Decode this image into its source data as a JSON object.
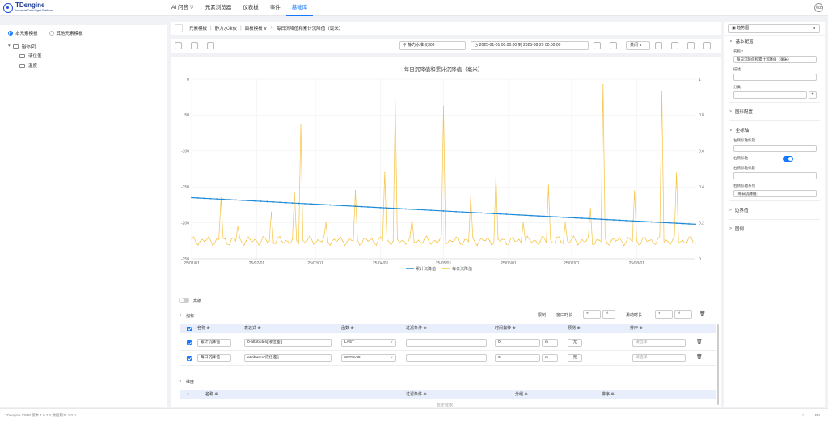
{
  "app": {
    "title": "TDengine",
    "subtitle": "Industrial Data Mgmt Platform",
    "user_initials": "WZ"
  },
  "nav": [
    {
      "label": "AI 问答 ▽"
    },
    {
      "label": "元素浏览器"
    },
    {
      "label": "仪表板"
    },
    {
      "label": "事件"
    },
    {
      "label": "基础库"
    }
  ],
  "left": {
    "radio_this": "本元素模板",
    "radio_other": "其他元素模板",
    "tree_group": "指标(2)",
    "tree_items": [
      "液位差",
      "温度"
    ]
  },
  "breadcrumb": [
    "元素模板",
    "静力水准仪",
    "面板模板 ∨",
    "每日沉降值和累计沉降值（毫米）"
  ],
  "toolbar": {
    "device": "静力水准仪308",
    "time_range": "2025-01-01 00:00:00 到 2025-08-29 00:00:00",
    "refresh": "关闭",
    "view": "趋势图"
  },
  "chart_data": {
    "type": "line",
    "title": "每日沉降值和累计沉降值（毫米）",
    "x": [
      "25/01/01",
      "25/02/01",
      "25/03/01",
      "25/04/01",
      "25/05/01",
      "25/06/01",
      "25/07/01",
      "25/08/01"
    ],
    "y_left_ticks": [
      "0",
      "-50",
      "-100",
      "-150",
      "-200",
      "-250"
    ],
    "y_right_ticks": [
      "1",
      "0.8",
      "0.6",
      "0.4",
      "0.2",
      "0"
    ],
    "ylim_left": [
      -250,
      0
    ],
    "ylim_right": [
      0,
      1
    ],
    "series": [
      {
        "name": "累计沉降值",
        "color": "#1f8ad6",
        "axis": "left",
        "start": -165,
        "end": -202
      },
      {
        "name": "每日沉降值",
        "color": "#f5c242",
        "axis": "right",
        "baseline": 0.1,
        "spikes": [
          {
            "day": 14,
            "v": 0.34
          },
          {
            "day": 22,
            "v": 0.18
          },
          {
            "day": 38,
            "v": 0.26
          },
          {
            "day": 49,
            "v": 0.37
          },
          {
            "day": 52,
            "v": 0.75
          },
          {
            "day": 64,
            "v": 0.2
          },
          {
            "day": 78,
            "v": 0.38
          },
          {
            "day": 92,
            "v": 0.48
          },
          {
            "day": 97,
            "v": 0.88
          },
          {
            "day": 105,
            "v": 0.22
          },
          {
            "day": 120,
            "v": 0.85
          },
          {
            "day": 133,
            "v": 0.35
          },
          {
            "day": 145,
            "v": 0.47
          },
          {
            "day": 158,
            "v": 0.2
          },
          {
            "day": 170,
            "v": 0.41
          },
          {
            "day": 178,
            "v": 0.2
          },
          {
            "day": 190,
            "v": 0.28
          },
          {
            "day": 196,
            "v": 0.97
          },
          {
            "day": 211,
            "v": 0.38
          },
          {
            "day": 224,
            "v": 0.93
          },
          {
            "day": 231,
            "v": 0.48
          }
        ]
      }
    ],
    "legend": "bottom-center"
  },
  "panel": {
    "advanced": "高级",
    "metrics_title": "指标",
    "limit_label": "限制",
    "window_label": "窗口时长",
    "window_value": "2",
    "window_unit": "d",
    "slide_label": "滑动时长",
    "slide_value": "1",
    "slide_unit": "d",
    "columns": [
      "名称 ⊕",
      "表达式 ⊕",
      "函数 ⊕",
      "过滤条件 ⊕",
      "时间偏移 ⊕",
      "预测 ⊕",
      "排序 ⊕"
    ],
    "rows": [
      {
        "name": "累计沉降值",
        "expr": "0-attributes['液位差']",
        "func": "LAST",
        "offset": "0",
        "offset_unit": "m",
        "forecast": "无",
        "sort": "请选择"
      },
      {
        "name": "每日沉降值",
        "expr": "attributes['液位差']",
        "func": "SPREAD",
        "offset": "0",
        "offset_unit": "m",
        "forecast": "无",
        "sort": "请选择"
      }
    ],
    "dims_title": "维度",
    "dims_columns": [
      "名称 ⊕",
      "过滤条件 ⊕",
      "分组 ⊕",
      "排序 ⊕"
    ],
    "empty": "暂无数据"
  },
  "right": {
    "basic": "基本配置",
    "name_label": "名称 *",
    "name_value": "每日沉降值和累计沉降值（毫米）",
    "desc_label": "描述",
    "cat_label": "分类",
    "chart_cfg": "图形配置",
    "axis": "坐标轴",
    "left_axis_label": "左侧标轴标题",
    "right_axis_toggle": "右侧标轴",
    "right_axis_title": "右侧标轴标题",
    "right_axis_series": "右侧标轴系列",
    "right_axis_tag": "每日沉降值",
    "border": "边界值",
    "legend": "图例"
  },
  "footer": {
    "version": "TDengine IDMP 版本 1.0.2.2 数据版本 1.0.0",
    "lang": "EN"
  }
}
